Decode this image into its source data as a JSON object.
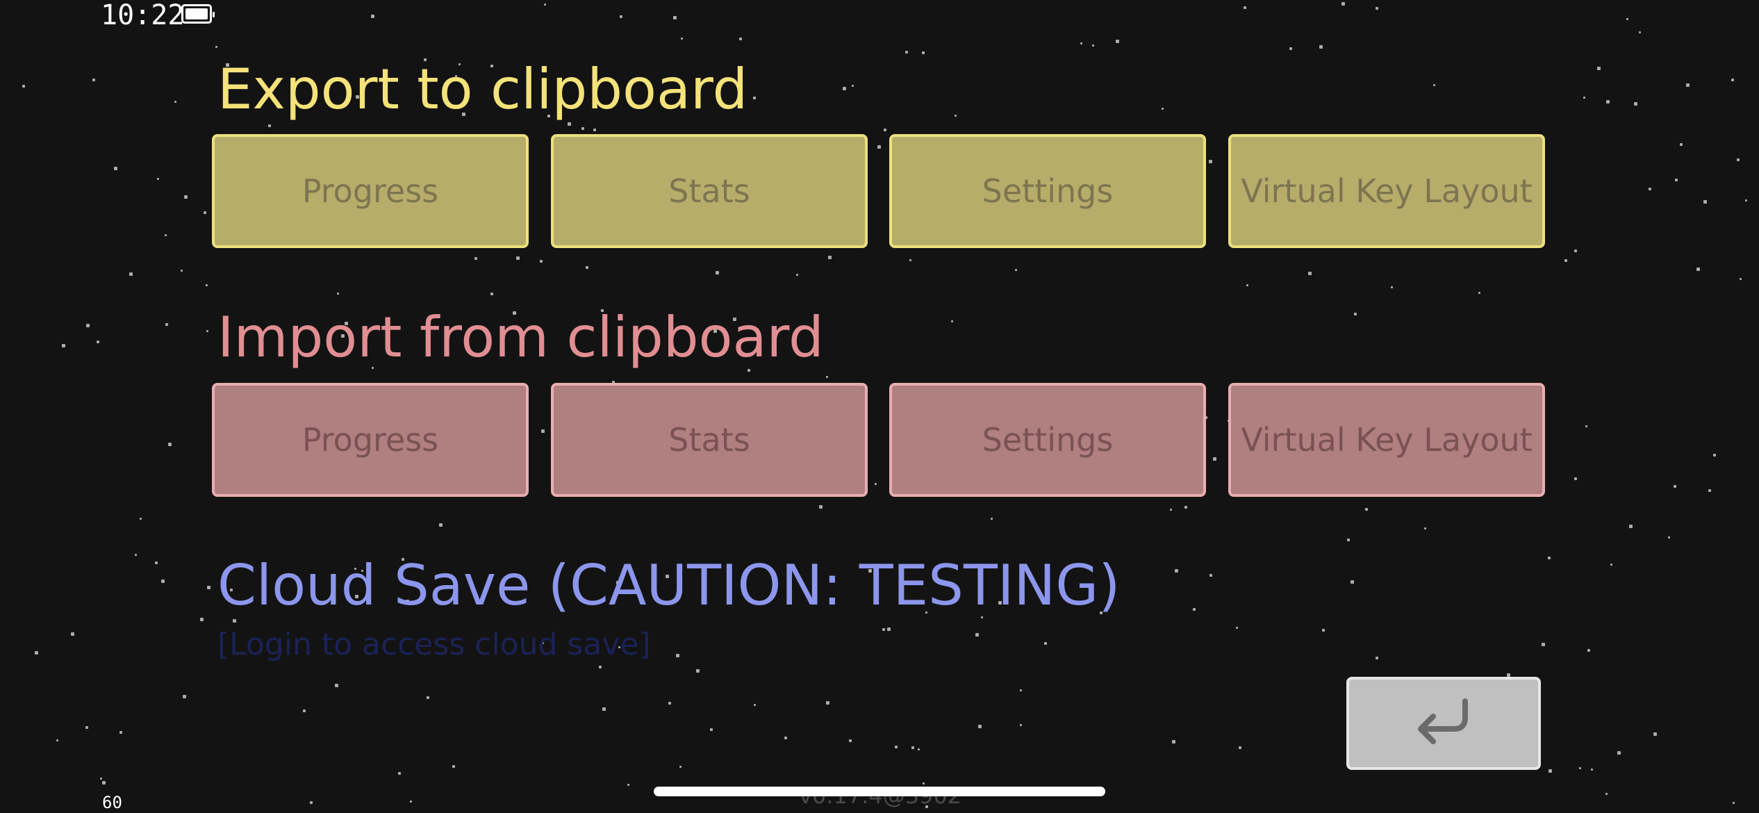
{
  "status_bar": {
    "time": "10:22"
  },
  "export_section": {
    "title": "Export to clipboard",
    "buttons": [
      "Progress",
      "Stats",
      "Settings",
      "Virtual Key Layout"
    ]
  },
  "import_section": {
    "title": "Import from clipboard",
    "buttons": [
      "Progress",
      "Stats",
      "Settings",
      "Virtual Key Layout"
    ]
  },
  "cloud_section": {
    "title": "Cloud Save (CAUTION: TESTING)",
    "login_link": "[Login to access cloud save]"
  },
  "back_button": {
    "icon": "return-arrow-icon"
  },
  "fps": "60",
  "version": "v0.17.4@3902",
  "colors": {
    "background": "#131313",
    "export_accent": "#f4e27a",
    "import_accent": "#e18e93",
    "cloud_accent": "#8c96ec"
  }
}
